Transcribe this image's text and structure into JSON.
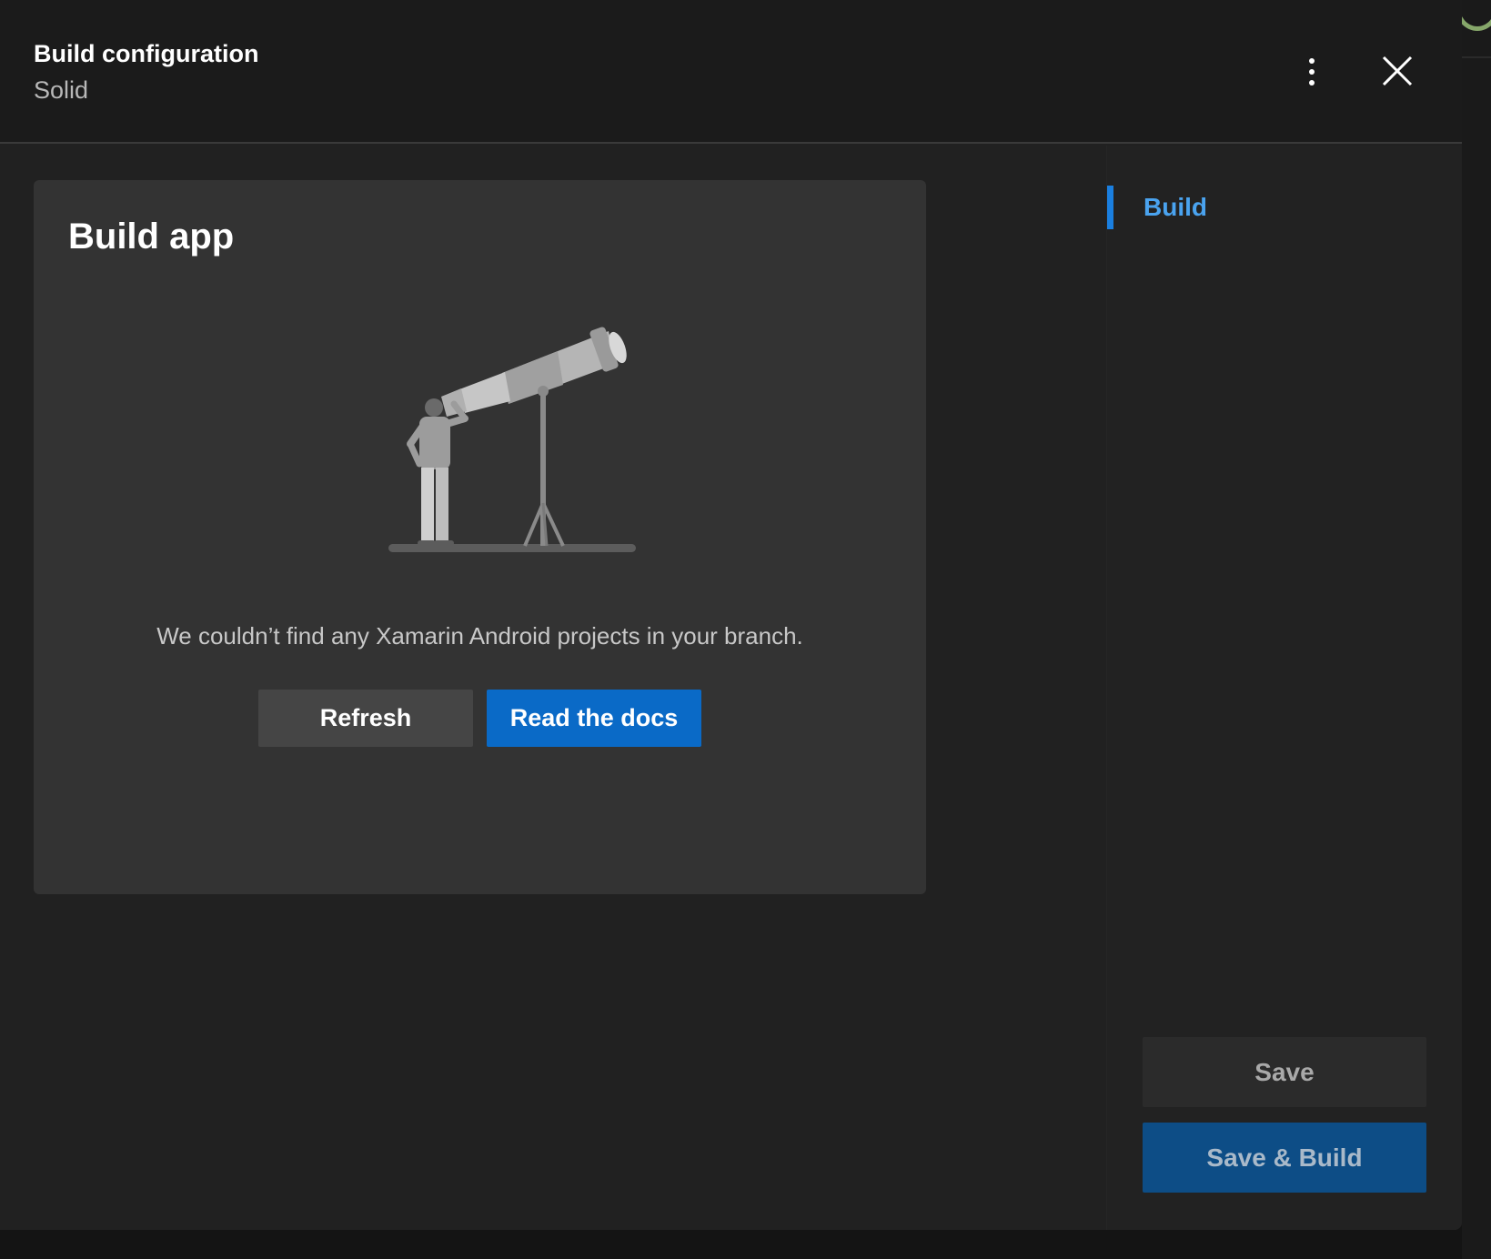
{
  "header": {
    "title": "Build configuration",
    "subtitle": "Solid"
  },
  "card": {
    "title": "Build app",
    "empty_message": "We couldn’t find any Xamarin Android projects in your branch.",
    "refresh_label": "Refresh",
    "docs_label": "Read the docs"
  },
  "sidenav": {
    "items": [
      {
        "label": "Build",
        "active": true
      }
    ]
  },
  "footer": {
    "save_label": "Save",
    "save_build_label": "Save & Build"
  },
  "colors": {
    "accent": "#0a6ac7",
    "nav_active": "#4aa3ef",
    "panel_bg": "#212121",
    "card_bg": "#333333"
  },
  "icons": {
    "more": "vertical-ellipsis-icon",
    "close": "close-icon",
    "illustration": "telescope-illustration"
  }
}
